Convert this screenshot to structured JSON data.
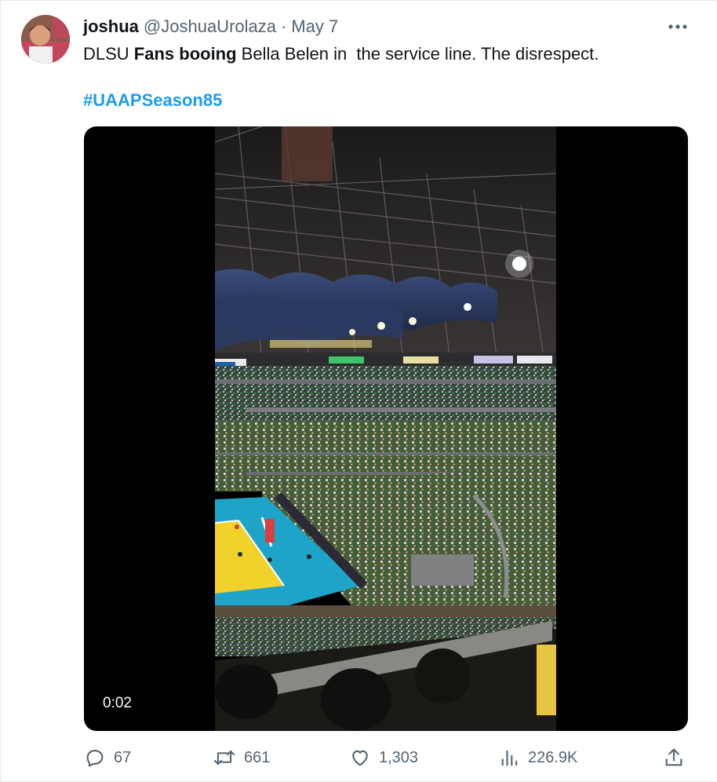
{
  "author": {
    "name": "joshua",
    "handle": "@JoshuaUrolaza",
    "separator": "·",
    "date": "May 7",
    "avatar_icon": "profile-photo"
  },
  "more_icon": "more-horizontal-icon",
  "tweet": {
    "text_parts": [
      "DLSU ",
      "Fans booing",
      " Bella Belen in  the service line. The disrespect."
    ],
    "hashtag": "#UAAPSeason85"
  },
  "media": {
    "type": "video",
    "timestamp": "0:02"
  },
  "actions": {
    "replies": {
      "icon": "reply-icon",
      "count": "67"
    },
    "retweets": {
      "icon": "retweet-icon",
      "count": "661"
    },
    "likes": {
      "icon": "like-icon",
      "count": "1,303"
    },
    "views": {
      "icon": "views-icon",
      "count": "226.9K"
    },
    "share": {
      "icon": "share-icon"
    }
  },
  "colors": {
    "text": "#0f1419",
    "secondary": "#536471",
    "link": "#1d9bf0",
    "court_blue": "#1fa4c9",
    "court_yellow": "#f2d12a"
  }
}
